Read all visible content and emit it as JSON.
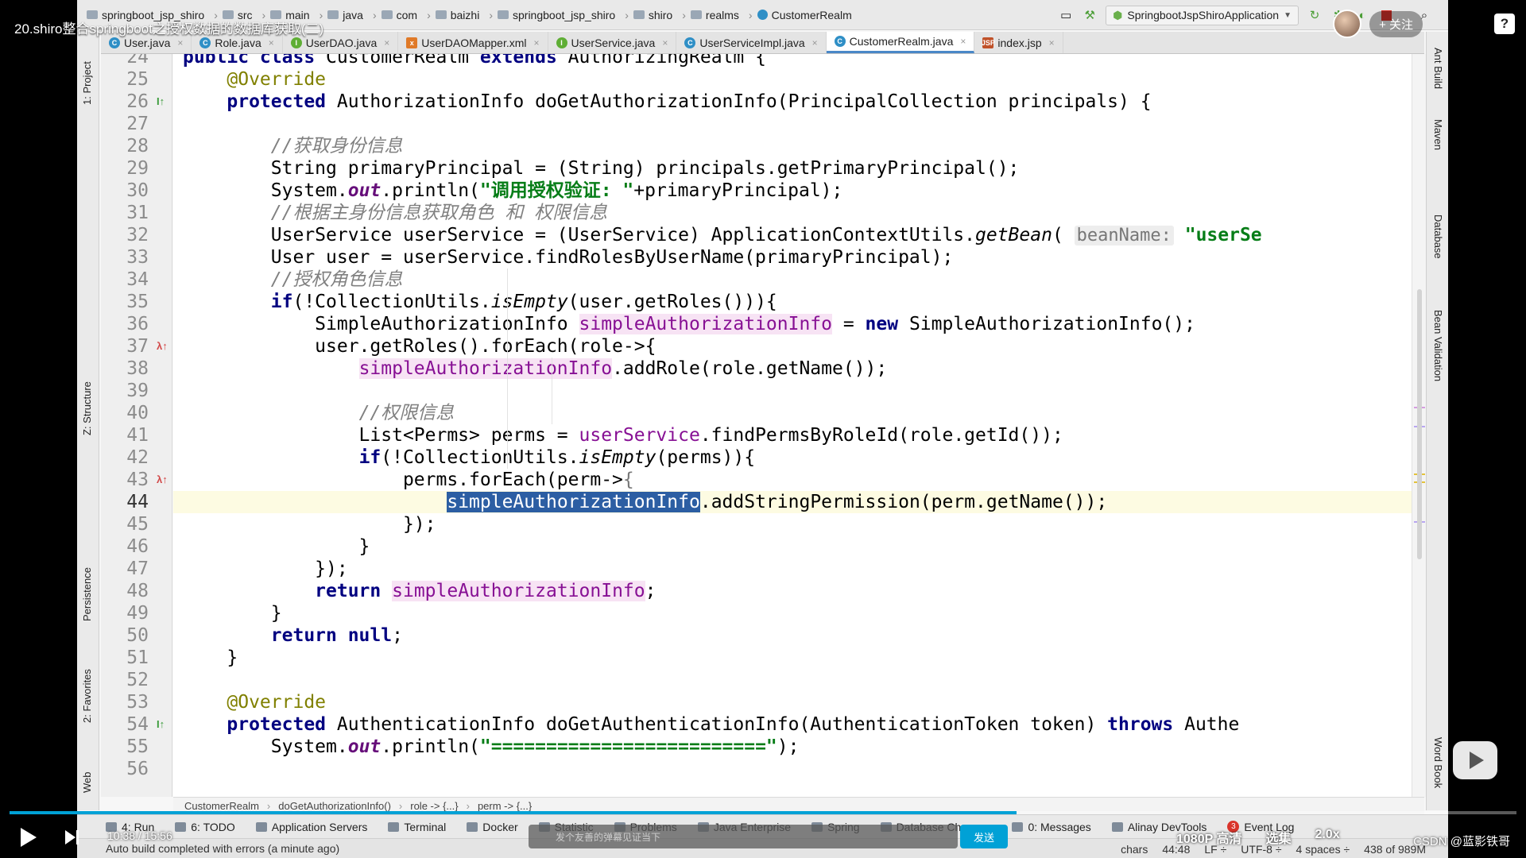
{
  "video": {
    "title": "20.shiro整合springboot之授权数据的数据库获取(二)",
    "follow_label": "+ 关注",
    "time": "10:38 / 15:56",
    "progress_fraction": 0.668,
    "danmu_placeholder": "发个友善的弹幕见证当下",
    "send_label": "发送",
    "quality": "1080P 高清",
    "episodes": "选集",
    "speed": "2.0x",
    "watermark": "CSDN @蓝影铁哥"
  },
  "navbar": {
    "crumbs": [
      "springboot_jsp_shiro",
      "src",
      "main",
      "java",
      "com",
      "baizhi",
      "springboot_jsp_shiro",
      "shiro",
      "realms",
      "CustomerRealm"
    ],
    "run_config": "SpringbootJspShiroApplication"
  },
  "tabs": [
    {
      "label": "User.java",
      "icon": "C",
      "kind": "c"
    },
    {
      "label": "Role.java",
      "icon": "C",
      "kind": "c"
    },
    {
      "label": "UserDAO.java",
      "icon": "I",
      "kind": "i"
    },
    {
      "label": "UserDAOMapper.xml",
      "icon": "x",
      "kind": "x"
    },
    {
      "label": "UserService.java",
      "icon": "I",
      "kind": "i"
    },
    {
      "label": "UserServiceImpl.java",
      "icon": "C",
      "kind": "c"
    },
    {
      "label": "CustomerRealm.java",
      "icon": "C",
      "kind": "c",
      "active": true
    },
    {
      "label": "index.jsp",
      "icon": "JSP",
      "kind": "j"
    }
  ],
  "left_tools": [
    "1: Project",
    "Z: Structure",
    "Persistence",
    "2: Favorites",
    "Web"
  ],
  "right_tools": [
    "Ant Build",
    "Maven",
    "Database",
    "Bean Validation",
    "Word Book"
  ],
  "editor": {
    "current_line": 44,
    "lines": [
      {
        "n": 24,
        "html": "<span class=\"kw\">public class</span> CustomerRealm <span class=\"kw\">extends</span> AuthorizingRealm {"
      },
      {
        "n": 25,
        "html": "    <span class=\"ann\">@Override</span>"
      },
      {
        "n": 26,
        "html": "    <span class=\"kw\">protected</span> AuthorizationInfo doGetAuthorizationInfo(PrincipalCollection principals) {"
      },
      {
        "n": 27,
        "html": ""
      },
      {
        "n": 28,
        "html": "        <span class=\"cm\">//获取身份信息</span>"
      },
      {
        "n": 29,
        "html": "        String primaryPrincipal = (String) principals.getPrimaryPrincipal();"
      },
      {
        "n": 30,
        "html": "        System.<span class=\"field\">out</span>.println(<span class=\"str\">\"调用授权验证: \"</span>+primaryPrincipal);"
      },
      {
        "n": 31,
        "html": "        <span class=\"cm\">//根据主身份信息获取角色 和 权限信息</span>"
      },
      {
        "n": 32,
        "html": "        UserService userService = (UserService) ApplicationContextUtils.<span class=\"it\">getBean</span>( <span class=\"hint\">beanName:</span> <span class=\"str\">\"userSe</span>"
      },
      {
        "n": 33,
        "html": "        User user = userService.findRolesByUserName(primaryPrincipal);"
      },
      {
        "n": 34,
        "html": "        <span class=\"cm\">//授权角色信息</span>"
      },
      {
        "n": 35,
        "html": "        <span class=\"kw\">if</span>(!CollectionUtils.<span class=\"it\">isEmpty</span>(user.getRoles())){"
      },
      {
        "n": 36,
        "html": "            SimpleAuthorizationInfo <span class=\"hlvar\">simpleAuthorizationInfo</span> = <span class=\"kw\">new</span> SimpleAuthorizationInfo();"
      },
      {
        "n": 37,
        "html": "            user.getRoles().forEach(role->{"
      },
      {
        "n": 38,
        "html": "                <span class=\"hlvar\">simpleAuthorizationInfo</span>.addRole(role.getName());"
      },
      {
        "n": 39,
        "html": ""
      },
      {
        "n": 40,
        "html": "                <span class=\"cm\">//权限信息</span>"
      },
      {
        "n": 41,
        "html": "                List&lt;Perms&gt; perms = <span class=\"mem\">userService</span>.findPermsByRoleId(role.getId());"
      },
      {
        "n": 42,
        "html": "                <span class=\"kw\">if</span>(!CollectionUtils.<span class=\"it\">isEmpty</span>(perms)){"
      },
      {
        "n": 43,
        "html": "                    perms.forEach(perm-><span class=\"brace\">{</span>"
      },
      {
        "n": 44,
        "html": "                        <span class=\"sel\">simpleAuthorizationInfo</span>.addStringPermission(perm.getName());"
      },
      {
        "n": 45,
        "html": "                    });"
      },
      {
        "n": 46,
        "html": "                }"
      },
      {
        "n": 47,
        "html": "            });"
      },
      {
        "n": 48,
        "html": "            <span class=\"kw\">return</span> <span class=\"hlvar\">simpleAuthorizationInfo</span>;"
      },
      {
        "n": 49,
        "html": "        }"
      },
      {
        "n": 50,
        "html": "        <span class=\"kw\">return null</span>;"
      },
      {
        "n": 51,
        "html": "    }"
      },
      {
        "n": 52,
        "html": ""
      },
      {
        "n": 53,
        "html": "    <span class=\"ann\">@Override</span>"
      },
      {
        "n": 54,
        "html": "    <span class=\"kw\">protected</span> AuthenticationInfo doGetAuthenticationInfo(AuthenticationToken token) <span class=\"kw\">throws</span> Authe"
      },
      {
        "n": 55,
        "html": "        System.<span class=\"field\">out</span>.println(<span class=\"str\">\"=========================\"</span>);"
      },
      {
        "n": 56,
        "html": ""
      }
    ]
  },
  "editor_crumbs": [
    "CustomerRealm",
    "doGetAuthorizationInfo()",
    "role -> {...}",
    "perm -> {...}"
  ],
  "tool_windows": [
    "4: Run",
    "6: TODO",
    "Application Servers",
    "Terminal",
    "Docker",
    "Statistic",
    "Problems",
    "Java Enterprise",
    "Spring",
    "Database Changes",
    "0: Messages",
    "Alinay DevTools",
    "Event Log"
  ],
  "event_log_count": "3",
  "status": {
    "message": "Auto build completed with errors (a minute ago)",
    "chars": "chars",
    "position": "44:48",
    "line_sep": "LF ÷",
    "encoding": "UTF-8 ÷",
    "indent": "4 spaces ÷",
    "memory": "438 of 989M"
  }
}
